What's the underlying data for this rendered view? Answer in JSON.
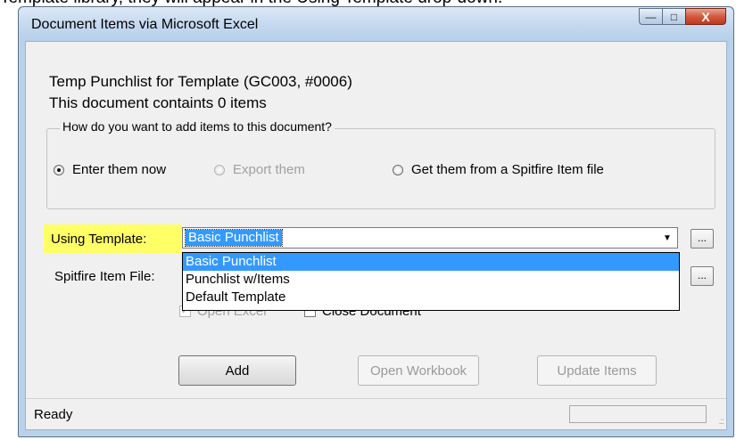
{
  "caption": "Template library, they will appear in the Using Template drop-down.",
  "window": {
    "title": "Document Items via Microsoft Excel",
    "minimize_label": "—",
    "maximize_label": "□",
    "close_label": "X"
  },
  "doc": {
    "title": "Temp Punchlist for Template (GC003, #0006)",
    "count": "This document containts 0 items"
  },
  "group": {
    "legend": "How do you want to add items to this document?",
    "options": [
      {
        "label": "Enter them now",
        "selected": true,
        "enabled": true
      },
      {
        "label": "Export them",
        "selected": false,
        "enabled": false
      },
      {
        "label": "Get them from a Spitfire Item file",
        "selected": false,
        "enabled": true
      }
    ]
  },
  "template": {
    "label": "Using Template:",
    "value": "Basic Punchlist",
    "options": [
      "Basic Punchlist",
      "Punchlist w/Items",
      "Default Template"
    ],
    "browse_label": "...",
    "highlight_color": "#ffff66"
  },
  "item_file": {
    "label": "Spitfire Item File:",
    "value": "",
    "browse_label": "..."
  },
  "checks": {
    "open_excel": "Open Excel",
    "close_document": "Close Document"
  },
  "buttons": {
    "add": "Add",
    "open_workbook": "Open Workbook",
    "update_items": "Update Items"
  },
  "status": {
    "text": "Ready",
    "grip": ".::"
  },
  "icons": {
    "combo_arrow": "▼"
  }
}
